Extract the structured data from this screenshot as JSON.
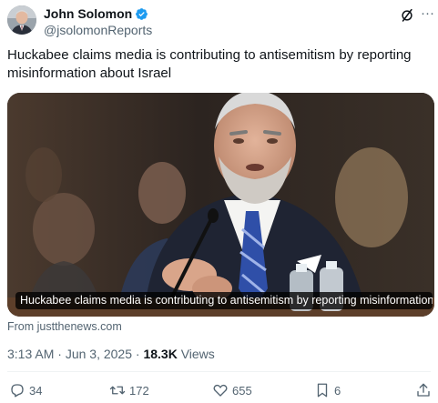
{
  "author": {
    "name": "John Solomon",
    "handle": "@jsolomonReports",
    "verified": true
  },
  "tweet": {
    "text": "Huckabee claims media is contributing to antisemitism by reporting misinformation about Israel"
  },
  "card": {
    "caption": "Huckabee claims media is contributing to antisemitism by reporting misinformation ab...",
    "source": "From justthenews.com"
  },
  "meta": {
    "time": "3:13 AM",
    "separator": " · ",
    "date": "Jun 3, 2025",
    "views_count": "18.3K",
    "views_label": " Views"
  },
  "actions": {
    "replies": "34",
    "reposts": "172",
    "likes": "655",
    "bookmarks": "6"
  },
  "icons": {
    "verified": "verified-badge-icon",
    "grok": "grok-icon",
    "more": "more-icon",
    "reply": "reply-icon",
    "repost": "repost-icon",
    "like": "heart-icon",
    "bookmark": "bookmark-icon",
    "share": "share-icon"
  },
  "colors": {
    "text": "#0f1419",
    "secondary": "#536471",
    "verified": "#1d9bf0"
  }
}
